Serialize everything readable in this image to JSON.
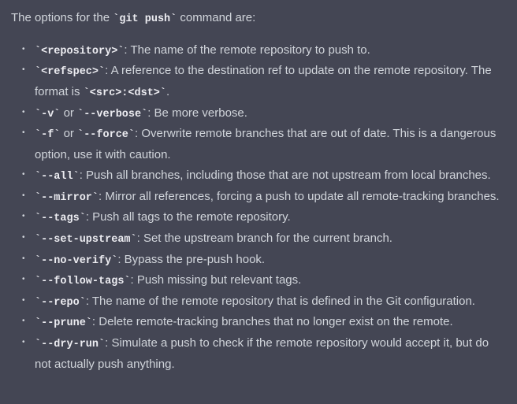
{
  "intro": {
    "prefix": "The options for the ",
    "cmd": "`git push`",
    "suffix": " command are:"
  },
  "options": [
    {
      "codes": [
        "`<repository>`"
      ],
      "sep": "",
      "desc": ": The name of the remote repository to push to."
    },
    {
      "codes": [
        "`<refspec>`"
      ],
      "sep": "",
      "desc_pre": ": A reference to the destination ref to update on the remote repository. The format is ",
      "codes2": [
        "`<src>:<dst>`"
      ],
      "desc_post": "."
    },
    {
      "codes": [
        "`-v`",
        "`--verbose`"
      ],
      "sep": " or ",
      "desc": ": Be more verbose."
    },
    {
      "codes": [
        "`-f`",
        "`--force`"
      ],
      "sep": " or ",
      "desc": ": Overwrite remote branches that are out of date. This is a dangerous option, use it with caution."
    },
    {
      "codes": [
        "`--all`"
      ],
      "sep": "",
      "desc": ": Push all branches, including those that are not upstream from local branches."
    },
    {
      "codes": [
        "`--mirror`"
      ],
      "sep": "",
      "desc": ": Mirror all references, forcing a push to update all remote-tracking branches."
    },
    {
      "codes": [
        "`--tags`"
      ],
      "sep": "",
      "desc": ": Push all tags to the remote repository."
    },
    {
      "codes": [
        "`--set-upstream`"
      ],
      "sep": "",
      "desc": ": Set the upstream branch for the current branch."
    },
    {
      "codes": [
        "`--no-verify`"
      ],
      "sep": "",
      "desc": ": Bypass the pre-push hook."
    },
    {
      "codes": [
        "`--follow-tags`"
      ],
      "sep": "",
      "desc": ": Push missing but relevant tags."
    },
    {
      "codes": [
        "`--repo`"
      ],
      "sep": "",
      "desc": ": The name of the remote repository that is defined in the Git configuration."
    },
    {
      "codes": [
        "`--prune`"
      ],
      "sep": "",
      "desc": ": Delete remote-tracking branches that no longer exist on the remote."
    },
    {
      "codes": [
        "`--dry-run`"
      ],
      "sep": "",
      "desc": ": Simulate a push to check if the remote repository would accept it, but do not actually push anything."
    }
  ]
}
